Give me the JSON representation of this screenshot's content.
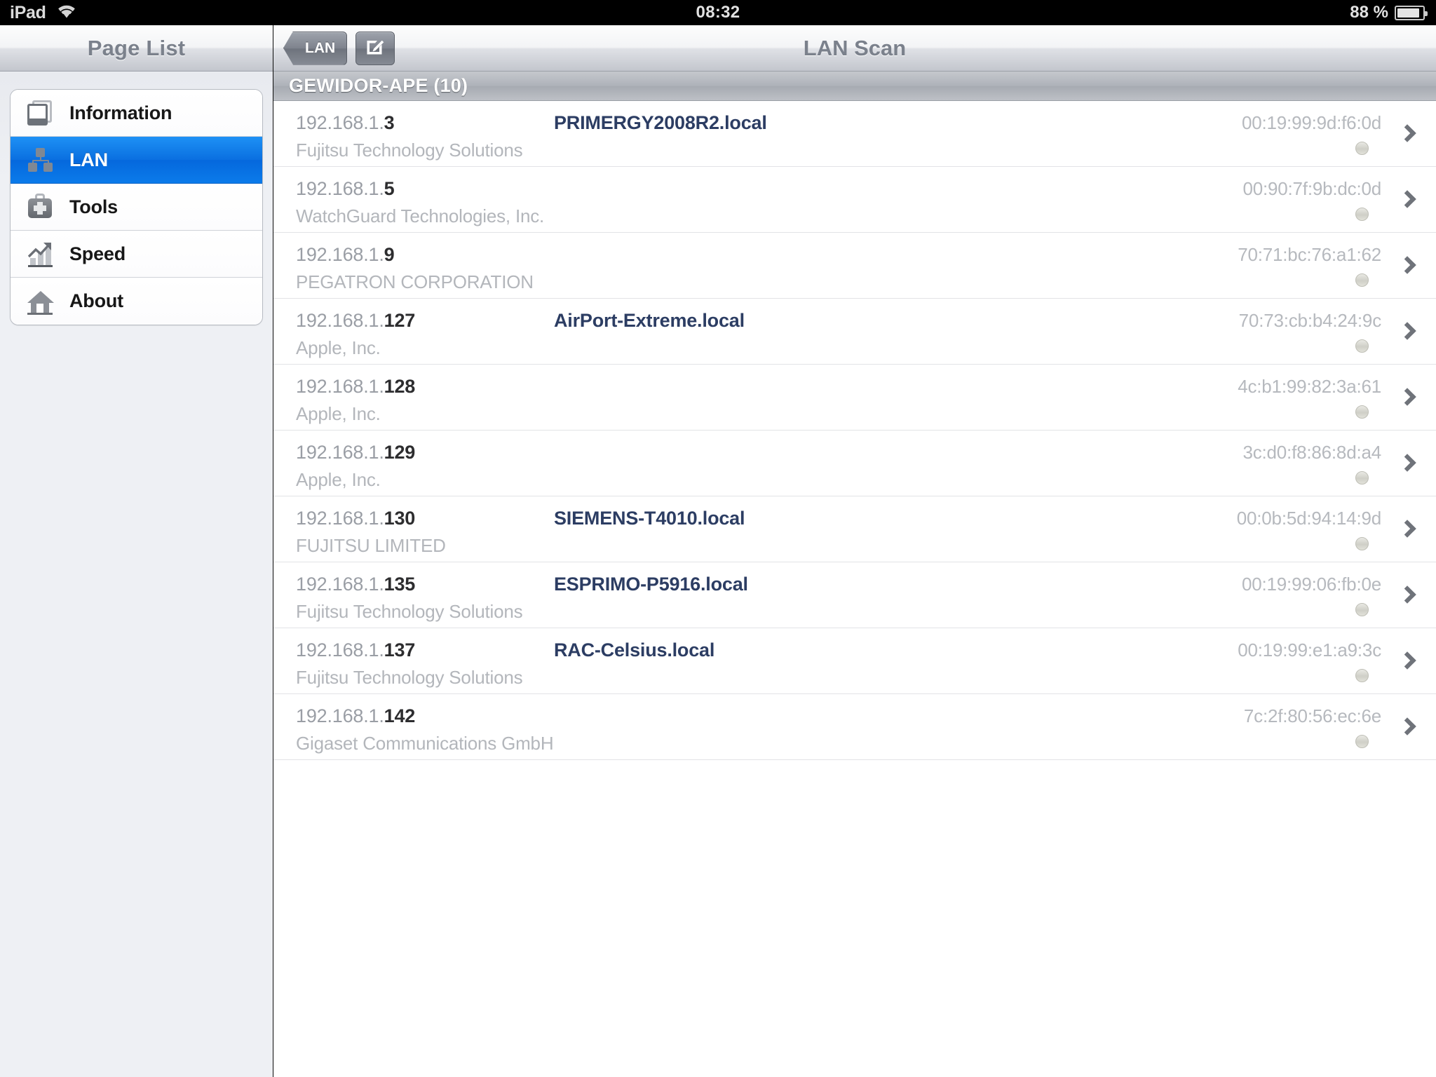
{
  "status_bar": {
    "device": "iPad",
    "wifi_icon": "wifi-icon",
    "time": "08:32",
    "battery_percent": "88 %",
    "battery_icon": "battery-icon"
  },
  "sidebar": {
    "title": "Page List",
    "items": [
      {
        "label": "Information",
        "icon": "tablet-icon",
        "selected": false
      },
      {
        "label": "LAN",
        "icon": "network-icon",
        "selected": true
      },
      {
        "label": "Tools",
        "icon": "toolbox-icon",
        "selected": false
      },
      {
        "label": "Speed",
        "icon": "chart-icon",
        "selected": false
      },
      {
        "label": "About",
        "icon": "house-icon",
        "selected": false
      }
    ]
  },
  "detail": {
    "title": "LAN Scan",
    "back_button": "LAN",
    "back_icon": "chevron-left-icon",
    "compose_button_icon": "compose-pencil-icon",
    "section_header": "GEWIDOR-APE (10)",
    "hosts": [
      {
        "ip_prefix": "192.168.1.",
        "ip_last": "3",
        "hostname": "PRIMERGY2008R2.local",
        "mac": "00:19:99:9d:f6:0d",
        "vendor": "Fujitsu Technology Solutions"
      },
      {
        "ip_prefix": "192.168.1.",
        "ip_last": "5",
        "hostname": "",
        "mac": "00:90:7f:9b:dc:0d",
        "vendor": "WatchGuard Technologies, Inc."
      },
      {
        "ip_prefix": "192.168.1.",
        "ip_last": "9",
        "hostname": "",
        "mac": "70:71:bc:76:a1:62",
        "vendor": "PEGATRON CORPORATION"
      },
      {
        "ip_prefix": "192.168.1.",
        "ip_last": "127",
        "hostname": "AirPort-Extreme.local",
        "mac": "70:73:cb:b4:24:9c",
        "vendor": "Apple, Inc."
      },
      {
        "ip_prefix": "192.168.1.",
        "ip_last": "128",
        "hostname": "",
        "mac": "4c:b1:99:82:3a:61",
        "vendor": "Apple, Inc."
      },
      {
        "ip_prefix": "192.168.1.",
        "ip_last": "129",
        "hostname": "",
        "mac": "3c:d0:f8:86:8d:a4",
        "vendor": "Apple, Inc."
      },
      {
        "ip_prefix": "192.168.1.",
        "ip_last": "130",
        "hostname": "SIEMENS-T4010.local",
        "mac": "00:0b:5d:94:14:9d",
        "vendor": "FUJITSU LIMITED"
      },
      {
        "ip_prefix": "192.168.1.",
        "ip_last": "135",
        "hostname": "ESPRIMO-P5916.local",
        "mac": "00:19:99:06:fb:0e",
        "vendor": "Fujitsu Technology Solutions"
      },
      {
        "ip_prefix": "192.168.1.",
        "ip_last": "137",
        "hostname": "RAC-Celsius.local",
        "mac": "00:19:99:e1:a9:3c",
        "vendor": "Fujitsu Technology Solutions"
      },
      {
        "ip_prefix": "192.168.1.",
        "ip_last": "142",
        "hostname": "",
        "mac": "7c:2f:80:56:ec:6e",
        "vendor": "Gigaset Communications GmbH"
      }
    ]
  },
  "colors": {
    "selection_blue": "#0a6fe0",
    "hostname_blue": "#2c3d63",
    "chrome_gray": "#c3c6cd"
  }
}
